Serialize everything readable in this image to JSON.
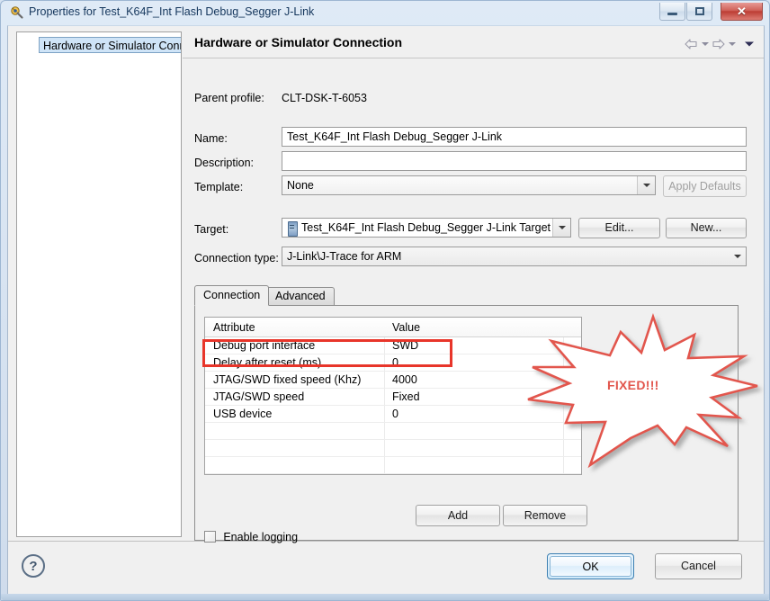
{
  "window": {
    "title": "Properties for Test_K64F_Int Flash Debug_Segger J-Link",
    "app_icon": "properties-icon",
    "controls": {
      "minimize": "minimize-icon",
      "maximize": "maximize-icon",
      "close": "✕"
    }
  },
  "tree": {
    "items": [
      {
        "label": "Hardware or Simulator Conn",
        "selected": true
      }
    ]
  },
  "pane": {
    "title": "Hardware or Simulator Connection",
    "nav": {
      "back": "back-arrow-icon",
      "back_menu": "chevron-down-icon",
      "forward": "forward-arrow-icon",
      "forward_menu": "chevron-down-icon",
      "view_menu": "chevron-down-icon"
    }
  },
  "form": {
    "parent_profile_label": "Parent profile:",
    "parent_profile_value": "CLT-DSK-T-6053",
    "name_label": "Name:",
    "name_value": "Test_K64F_Int Flash Debug_Segger J-Link",
    "description_label": "Description:",
    "description_value": "",
    "description_placeholder": "",
    "template_label": "Template:",
    "template_value": "None",
    "apply_defaults_label": "Apply Defaults",
    "target_label": "Target:",
    "target_value": "Test_K64F_Int Flash Debug_Segger J-Link Target",
    "target_icon": "device-icon",
    "edit_label": "Edit...",
    "new_label": "New...",
    "connection_type_label": "Connection type:",
    "connection_type_value": "J-Link\\J-Trace for ARM"
  },
  "tabs": [
    {
      "label": "Connection",
      "active": true
    },
    {
      "label": "Advanced",
      "active": false
    }
  ],
  "table": {
    "columns": [
      "Attribute",
      "Value"
    ],
    "rows": [
      {
        "attribute": "Debug port interface",
        "value": "SWD",
        "highlighted": true
      },
      {
        "attribute": "Delay after reset (ms)",
        "value": "0",
        "highlighted": false
      },
      {
        "attribute": "JTAG/SWD fixed speed (Khz)",
        "value": "4000",
        "highlighted": false
      },
      {
        "attribute": "JTAG/SWD speed",
        "value": "Fixed",
        "highlighted": false
      },
      {
        "attribute": "USB device",
        "value": "0",
        "highlighted": false
      }
    ],
    "empty_rows": 4
  },
  "table_buttons": {
    "add_label": "Add",
    "remove_label": "Remove"
  },
  "checkbox": {
    "label": "Enable logging",
    "checked": false
  },
  "annotation": {
    "text": "FIXED!!!",
    "shape": "starburst",
    "color": "#e2564d",
    "highlight_color": "#e8352a"
  },
  "footer": {
    "help_label": "?",
    "ok_label": "OK",
    "cancel_label": "Cancel"
  },
  "colors": {
    "accent": "#3c7fb1",
    "dialog_bg": "#f0f0f0",
    "title_text": "#14365c",
    "selection": "#cfe4f7"
  }
}
